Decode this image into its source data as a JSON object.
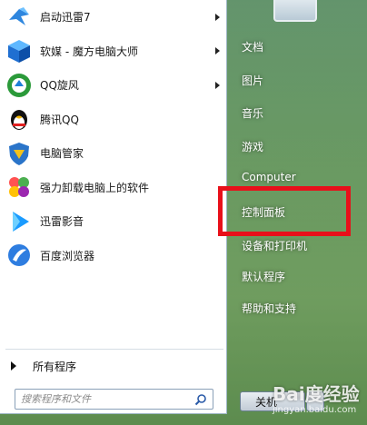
{
  "programs": [
    {
      "label": "启动迅雷7",
      "icon": "xunlei-bird-icon",
      "has_arrow": true
    },
    {
      "label": "软媒 - 魔方电脑大师",
      "icon": "cube-icon",
      "has_arrow": true
    },
    {
      "label": "QQ旋风",
      "icon": "qq-whirlwind-icon",
      "has_arrow": true
    },
    {
      "label": "腾讯QQ",
      "icon": "qq-penguin-icon",
      "has_arrow": false
    },
    {
      "label": "电脑管家",
      "icon": "shield-icon",
      "has_arrow": false
    },
    {
      "label": "强力卸载电脑上的软件",
      "icon": "uninstall-clover-icon",
      "has_arrow": false
    },
    {
      "label": "迅雷影音",
      "icon": "play-icon",
      "has_arrow": false
    },
    {
      "label": "百度浏览器",
      "icon": "browser-icon",
      "has_arrow": false
    }
  ],
  "all_programs": "所有程序",
  "search": {
    "placeholder": "搜索程序和文件"
  },
  "right": {
    "documents": "文档",
    "pictures": "图片",
    "music": "音乐",
    "games": "游戏",
    "computer": "Computer",
    "control_panel": "控制面板",
    "devices_printers": "设备和打印机",
    "default_programs": "默认程序",
    "help_support": "帮助和支持"
  },
  "shutdown": {
    "label": "关机"
  },
  "watermark": {
    "text": "Bai度经验",
    "sub": "jingyan.baidu.com"
  },
  "colors": {
    "highlight": "#e8101a"
  }
}
